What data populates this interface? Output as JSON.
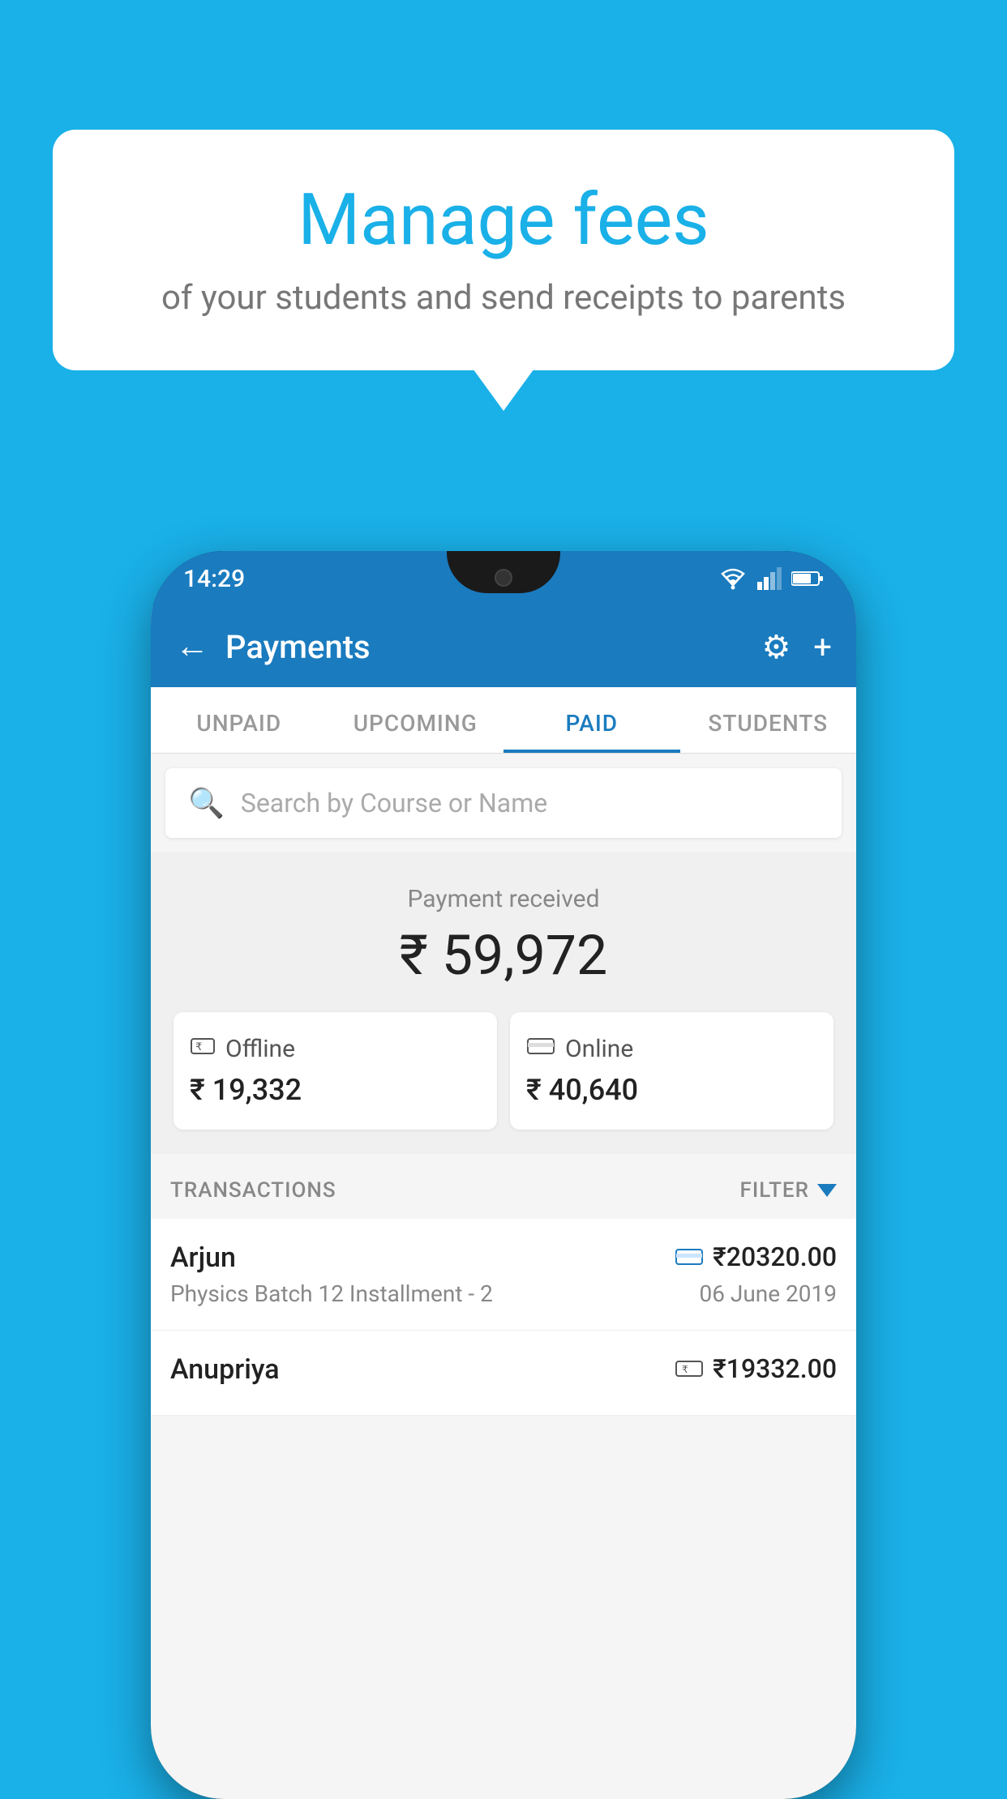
{
  "background_color": "#1ab0e8",
  "bubble": {
    "title": "Manage fees",
    "subtitle": "of your students and send receipts to parents"
  },
  "phone": {
    "status_bar": {
      "time": "14:29"
    },
    "app_bar": {
      "title": "Payments",
      "back_label": "←",
      "gear_label": "⚙",
      "plus_label": "+"
    },
    "tabs": [
      {
        "label": "UNPAID",
        "active": false
      },
      {
        "label": "UPCOMING",
        "active": false
      },
      {
        "label": "PAID",
        "active": true
      },
      {
        "label": "STUDENTS",
        "active": false
      }
    ],
    "search": {
      "placeholder": "Search by Course or Name"
    },
    "payment_summary": {
      "label": "Payment received",
      "amount": "₹ 59,972",
      "offline": {
        "label": "Offline",
        "amount": "₹ 19,332"
      },
      "online": {
        "label": "Online",
        "amount": "₹ 40,640"
      }
    },
    "transactions": {
      "header_label": "TRANSACTIONS",
      "filter_label": "FILTER",
      "rows": [
        {
          "name": "Arjun",
          "course": "Physics Batch 12 Installment - 2",
          "amount": "₹20320.00",
          "date": "06 June 2019",
          "payment_type": "online"
        },
        {
          "name": "Anupriya",
          "course": "",
          "amount": "₹19332.00",
          "date": "",
          "payment_type": "offline"
        }
      ]
    }
  }
}
